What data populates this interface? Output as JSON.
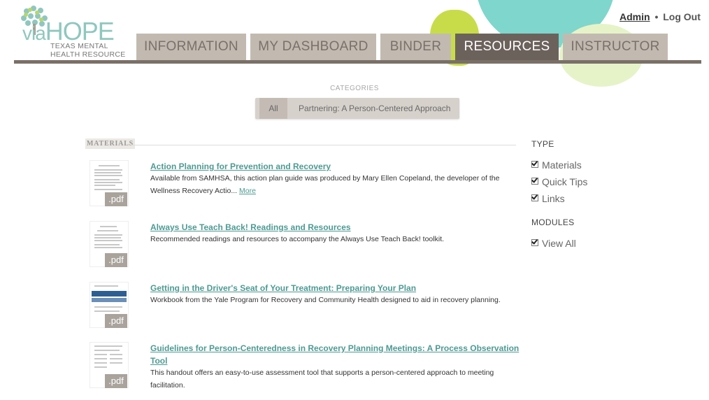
{
  "logo": {
    "via": "via",
    "hope": "HOPE",
    "tagline_line1": "TEXAS MENTAL",
    "tagline_line2": "HEALTH RESOURCE"
  },
  "user": {
    "admin_label": "Admin",
    "separator": "•",
    "logout_label": "Log Out"
  },
  "nav": {
    "tabs": [
      {
        "label": "INFORMATION",
        "active": false
      },
      {
        "label": "MY DASHBOARD",
        "active": false
      },
      {
        "label": "BINDER",
        "active": false
      },
      {
        "label": "RESOURCES",
        "active": true
      },
      {
        "label": "INSTRUCTOR",
        "active": false
      }
    ]
  },
  "categories": {
    "heading": "CATEGORIES",
    "items": [
      "All",
      "Partnering: A Person-Centered Approach"
    ]
  },
  "materials": {
    "heading": "MATERIALS",
    "badge": ".pdf",
    "items": [
      {
        "title": "Action Planning for Prevention and Recovery",
        "desc_line1": "Available from SAMHSA, this action plan guide was produced by Mary Ellen Copeland, the developer of the",
        "desc_line2": "Wellness Recovery Actio...",
        "more": "More"
      },
      {
        "title": "Always Use Teach Back! Readings and Resources",
        "desc_line1": "Recommended readings and resources to accompany the Always Use Teach Back! toolkit."
      },
      {
        "title": "Getting in the Driver's Seat of Your Treatment: Preparing Your Plan",
        "desc_line1": "Workbook from the Yale Program for Recovery and Community Health designed to aid in recovery planning."
      },
      {
        "title_line1": "Guidelines for Person-Centeredness in Recovery Planning Meetings: A Process Observation",
        "title_line2": "Tool",
        "desc_line1": "This handout offers an easy-to-use assessment tool that supports a person-centered approach to meeting",
        "desc_line2": "facilitation."
      }
    ]
  },
  "filters": {
    "type_heading": "TYPE",
    "type_options": [
      "Materials",
      "Quick Tips",
      "Links"
    ],
    "modules_heading": "MODULES",
    "modules_options": [
      "View All"
    ]
  },
  "colors": {
    "nav_tab": "#c2bab1",
    "nav_tab_active": "#6c625c",
    "link_teal": "#4e9a93",
    "pdf_badge": "#a9a39c"
  }
}
